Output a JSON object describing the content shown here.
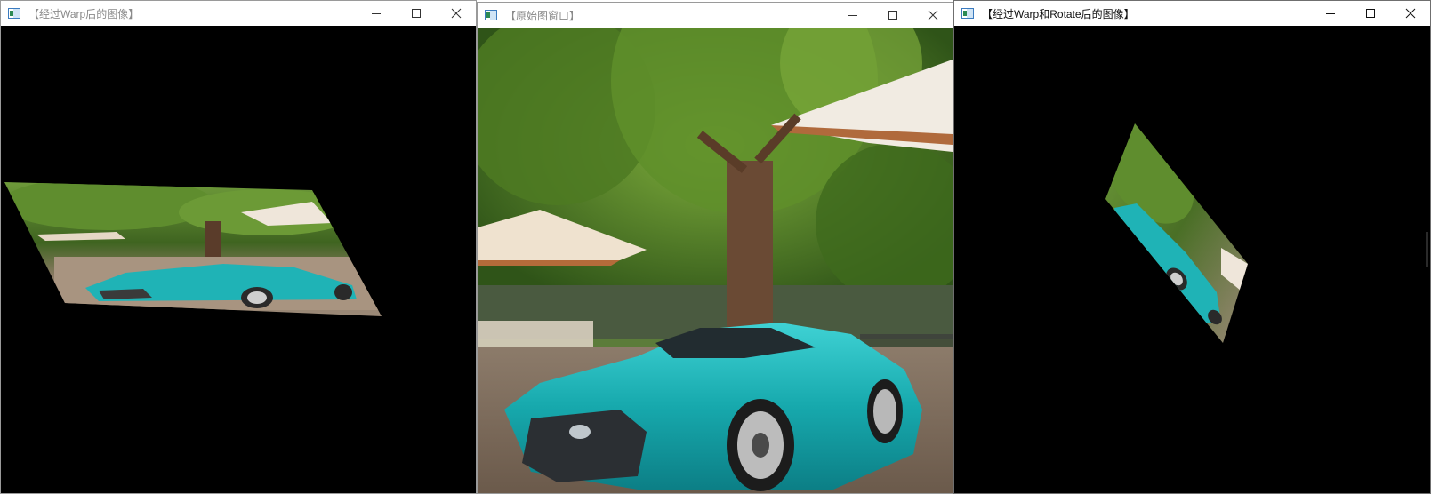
{
  "windows": [
    {
      "title": "【经过Warp后的图像】",
      "active": false,
      "controls": {
        "minimize": "minimize-icon",
        "maximize": "maximize-icon",
        "close": "close-icon"
      }
    },
    {
      "title": "【原始图窗口】",
      "active": false,
      "controls": {
        "minimize": "minimize-icon",
        "maximize": "maximize-icon",
        "close": "close-icon"
      }
    },
    {
      "title": "【经过Warp和Rotate后的图像】",
      "active": true,
      "controls": {
        "minimize": "minimize-icon",
        "maximize": "maximize-icon",
        "close": "close-icon"
      }
    }
  ],
  "colors": {
    "canvas_background": "#000000",
    "titlebar": "#ffffff",
    "inactive_title_text": "#8a8a8a",
    "active_title_text": "#111111",
    "car_teal": "#1fb3b6",
    "foliage": "#4f7a2a"
  }
}
